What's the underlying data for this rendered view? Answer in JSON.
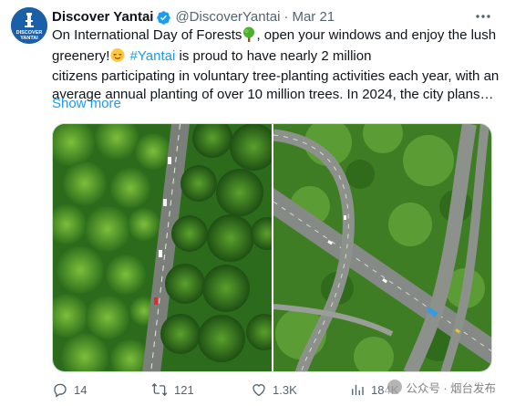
{
  "author": {
    "name": "Discover Yantai",
    "handle": "@DiscoverYantai",
    "separator": "·",
    "date": "Mar 21",
    "avatar_text_top": "DISCOVER",
    "avatar_text_bottom": "YANTAI",
    "verified_color": "#1d9bf0"
  },
  "tweet": {
    "line1_a": "On International Day of Forests",
    "line1_b": ", open your windows and enjoy the lush",
    "line2_a": "greenery!",
    "line2_hashtag": "#Yantai",
    "line2_b": " is proud to have nearly 2 million",
    "line3": "citizens participating in voluntary tree-planting activities each year, with an",
    "line4": "average annual planting of over 10 million trees. In 2024, the city plans…",
    "show_more": "Show more",
    "emoji_1": "tree-emoji",
    "emoji_2": "relieved-face-emoji"
  },
  "media": {
    "image_1": "aerial-forest-road",
    "image_2": "aerial-highway-interchange"
  },
  "actions": {
    "replies": "14",
    "reposts": "121",
    "likes": "1.3K",
    "views": "184K"
  },
  "watermark": {
    "text": "公众号 · 烟台发布"
  },
  "colors": {
    "accent": "#1d9bf0",
    "text": "#0f1419",
    "muted": "#536471"
  }
}
